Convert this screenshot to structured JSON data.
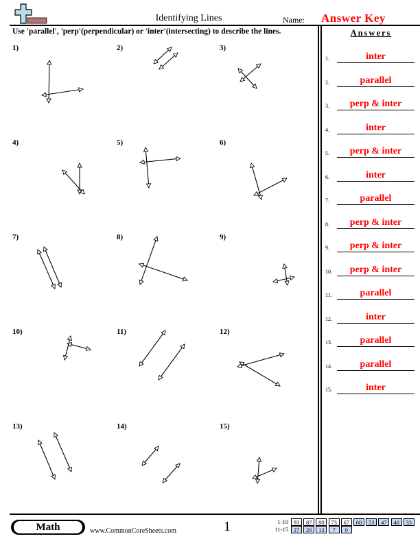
{
  "header": {
    "title": "Identifying Lines",
    "name_label": "Name:",
    "name_value": "Answer Key",
    "logo_icon": "plus-minus-logo-icon"
  },
  "instructions": "Use 'parallel', 'perp'(perpendicular) or 'inter'(intersecting) to describe the lines.",
  "problems": [
    {
      "label": "1)",
      "relation": "inter"
    },
    {
      "label": "2)",
      "relation": "parallel"
    },
    {
      "label": "3)",
      "relation": "perp & inter"
    },
    {
      "label": "4)",
      "relation": "inter"
    },
    {
      "label": "5)",
      "relation": "perp & inter"
    },
    {
      "label": "6)",
      "relation": "inter"
    },
    {
      "label": "7)",
      "relation": "parallel"
    },
    {
      "label": "8)",
      "relation": "perp & inter"
    },
    {
      "label": "9)",
      "relation": "perp & inter"
    },
    {
      "label": "10)",
      "relation": "perp & inter"
    },
    {
      "label": "11)",
      "relation": "parallel"
    },
    {
      "label": "12)",
      "relation": "inter"
    },
    {
      "label": "13)",
      "relation": "parallel"
    },
    {
      "label": "14)",
      "relation": "parallel"
    },
    {
      "label": "15)",
      "relation": "inter"
    }
  ],
  "answers": {
    "title": "Answers",
    "items": [
      {
        "num": "1.",
        "text": "inter"
      },
      {
        "num": "2.",
        "text": "parallel"
      },
      {
        "num": "3.",
        "text": "perp & inter"
      },
      {
        "num": "4.",
        "text": "inter"
      },
      {
        "num": "5.",
        "text": "perp & inter"
      },
      {
        "num": "6.",
        "text": "inter"
      },
      {
        "num": "7.",
        "text": "parallel"
      },
      {
        "num": "8.",
        "text": "perp & inter"
      },
      {
        "num": "9.",
        "text": "perp & inter"
      },
      {
        "num": "10.",
        "text": "perp & inter"
      },
      {
        "num": "11.",
        "text": "parallel"
      },
      {
        "num": "12.",
        "text": "inter"
      },
      {
        "num": "13.",
        "text": "parallel"
      },
      {
        "num": "14.",
        "text": "parallel"
      },
      {
        "num": "15.",
        "text": "inter"
      }
    ]
  },
  "footer": {
    "subject": "Math",
    "site": "www.CommonCoreSheets.com",
    "page": "1",
    "score_rows": [
      {
        "label": "1-10",
        "scores": [
          "93",
          "87",
          "80",
          "73",
          "67",
          "60",
          "53",
          "47",
          "40",
          "33"
        ],
        "highlight_from": 5
      },
      {
        "label": "11-15",
        "scores": [
          "27",
          "20",
          "13",
          "7",
          "0"
        ],
        "highlight_from": 0
      }
    ],
    "colors": {
      "highlight": "#c9ddf8",
      "answer": "#ff0000"
    }
  }
}
